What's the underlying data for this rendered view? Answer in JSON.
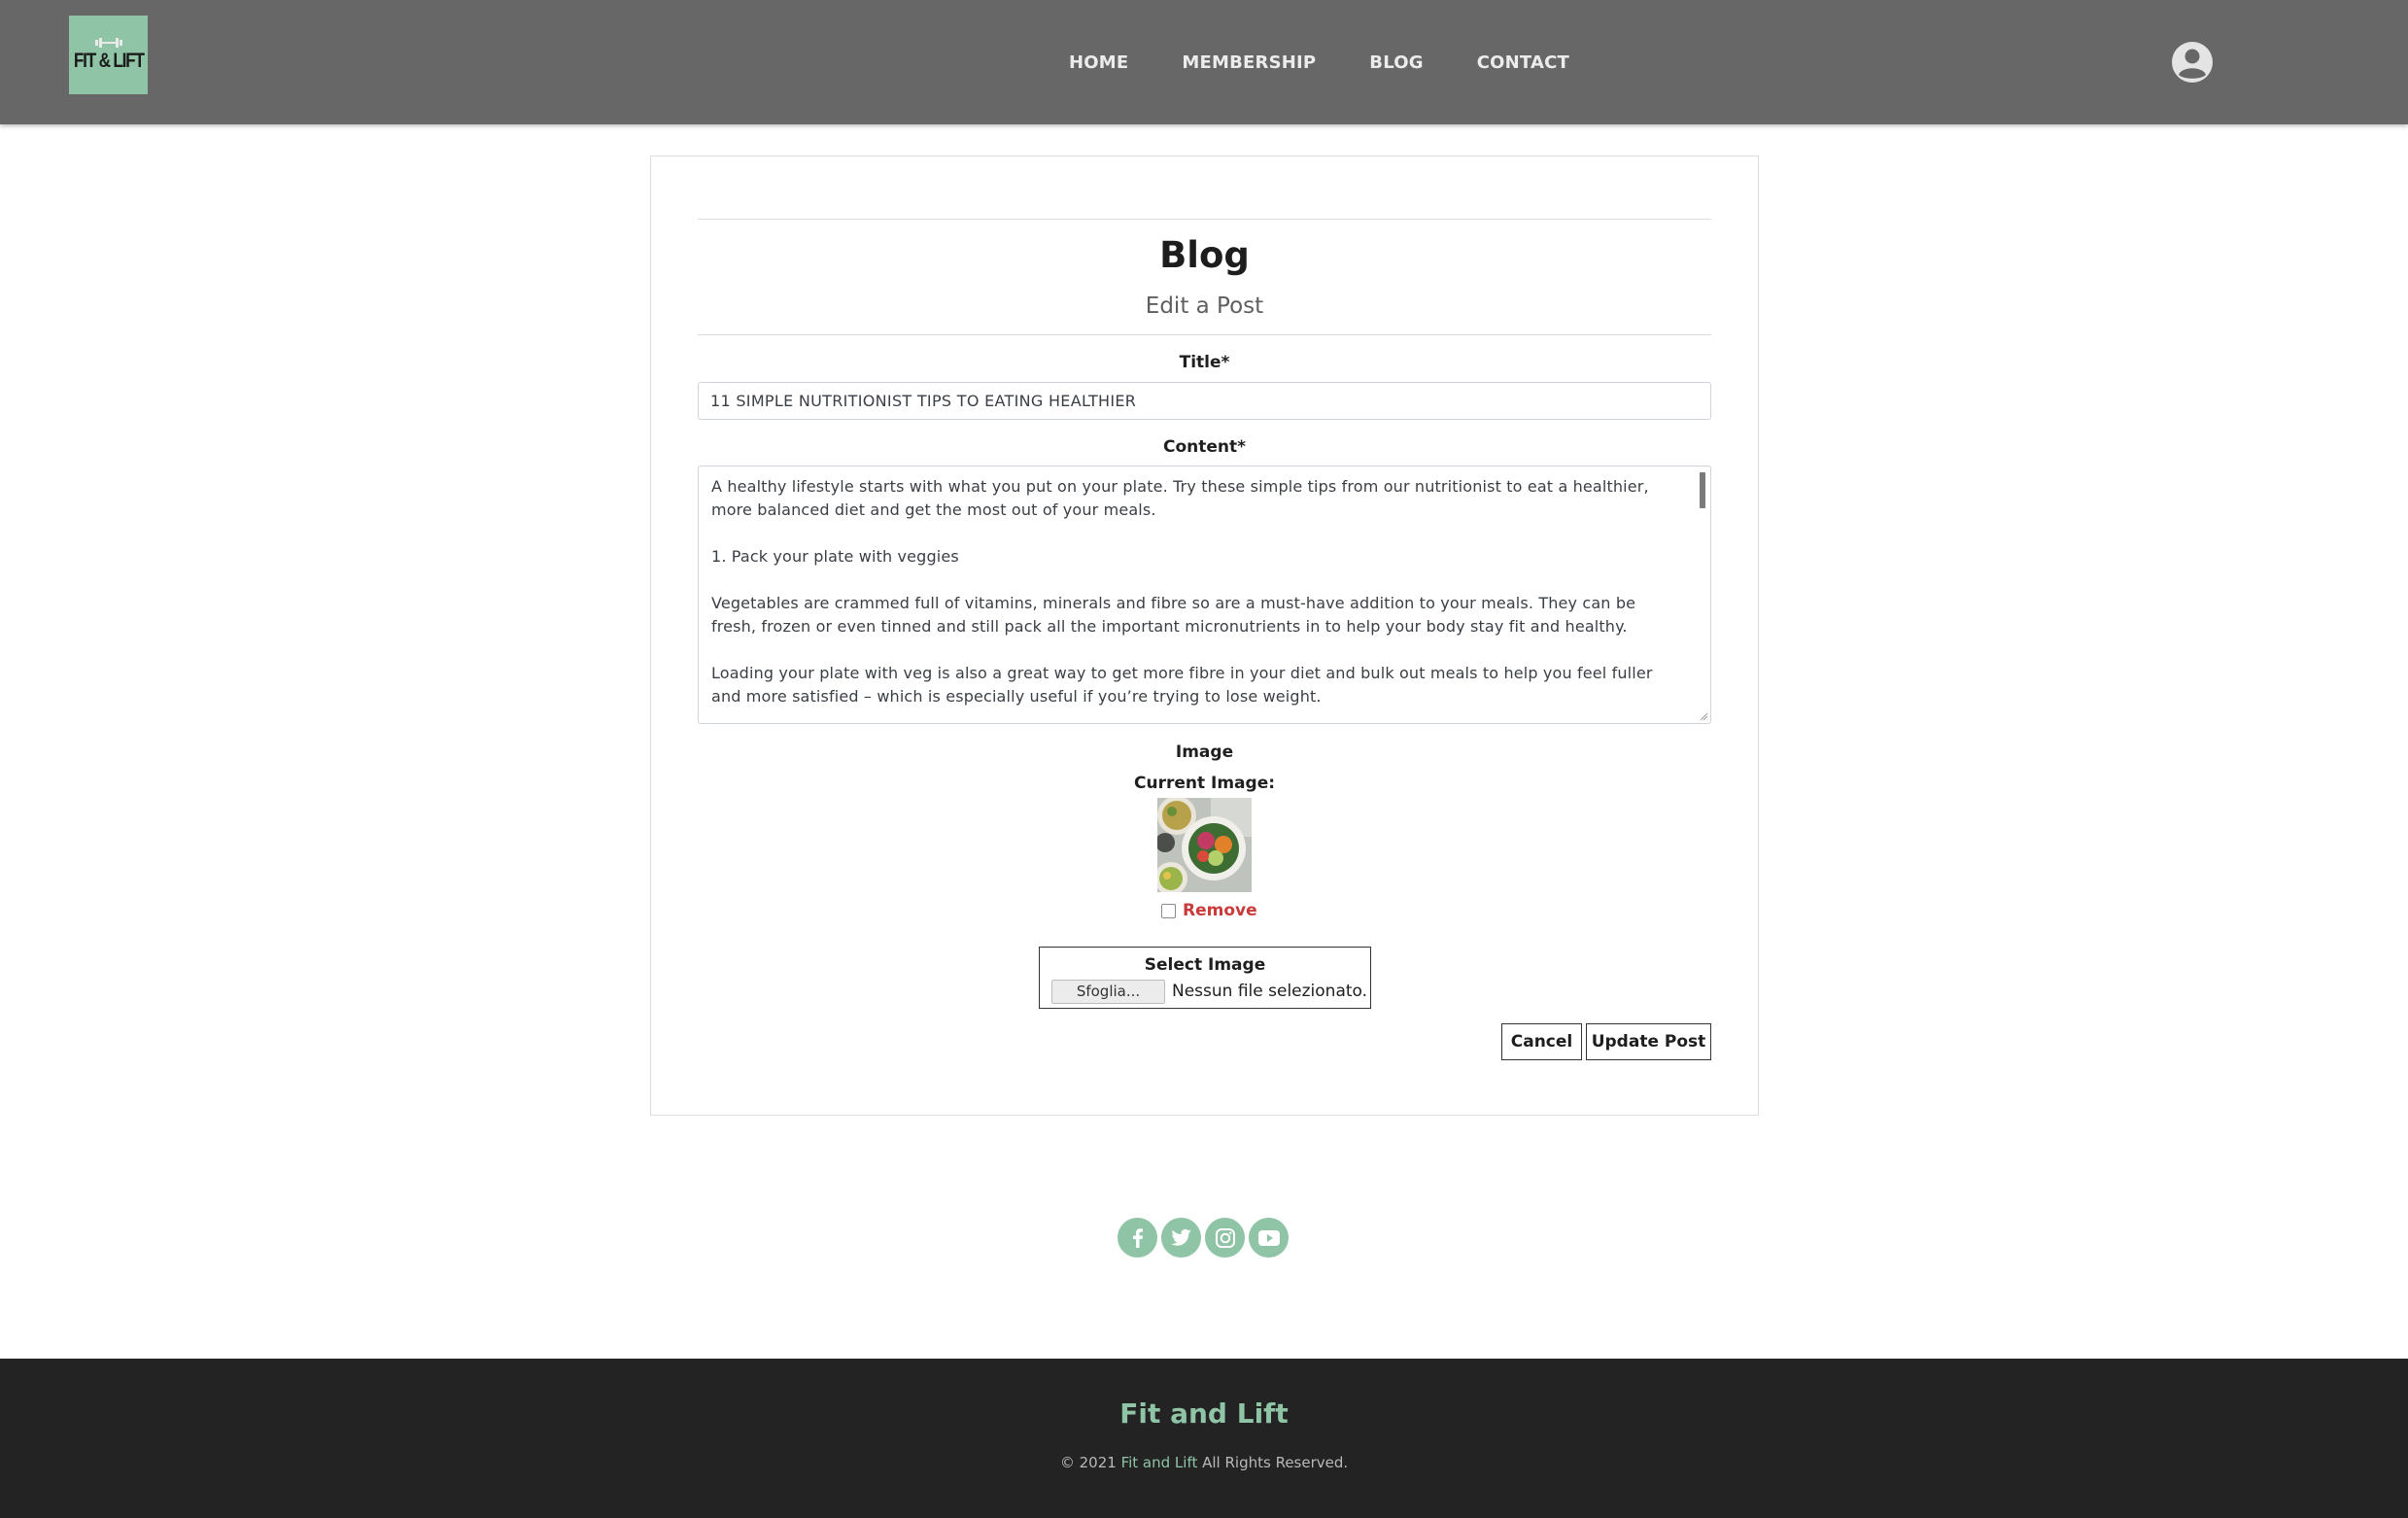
{
  "colors": {
    "header_bg": "#676767",
    "accent": "#8fc4a6",
    "footer_bg": "#232323",
    "remove_red": "#c93a3a"
  },
  "header": {
    "logo_text": "FIT & LIFT",
    "nav": [
      "HOME",
      "MEMBERSHIP",
      "BLOG",
      "CONTACT"
    ],
    "user_icon": "user-circle-icon"
  },
  "page": {
    "title": "Blog",
    "subtitle": "Edit a Post"
  },
  "form": {
    "title_label": "Title*",
    "title_value": "11 SIMPLE NUTRITIONIST TIPS TO EATING HEALTHIER",
    "content_label": "Content*",
    "content_paragraphs": [
      "A healthy lifestyle starts with what you put on your plate. Try these simple tips from our nutritionist to eat a healthier, more balanced diet and get the most out of your meals.",
      "1. Pack your plate with veggies",
      "Vegetables are crammed full of vitamins, minerals and fibre so are a must-have addition to your meals. They can be fresh, frozen or even tinned and still pack all the important micronutrients in to help your body stay fit and healthy.",
      "Loading your plate with veg is also a great way to get more fibre in your diet and bulk out meals to help you feel fuller and more satisfied – which is especially useful if you’re trying to lose weight."
    ],
    "image_label": "Image",
    "current_image_label": "Current Image:",
    "remove_label": "Remove",
    "select_image_label": "Select Image",
    "browse_label": "Sfoglia...",
    "file_status": "Nessun file selezionato.",
    "cancel_label": "Cancel",
    "update_label": "Update Post"
  },
  "social": [
    "facebook-icon",
    "twitter-icon",
    "instagram-icon",
    "youtube-icon"
  ],
  "footer": {
    "brand": "Fit and Lift",
    "copy_prefix": "© 2021",
    "copy_brand": "Fit and Lift",
    "copy_suffix": "All Rights Reserved."
  }
}
